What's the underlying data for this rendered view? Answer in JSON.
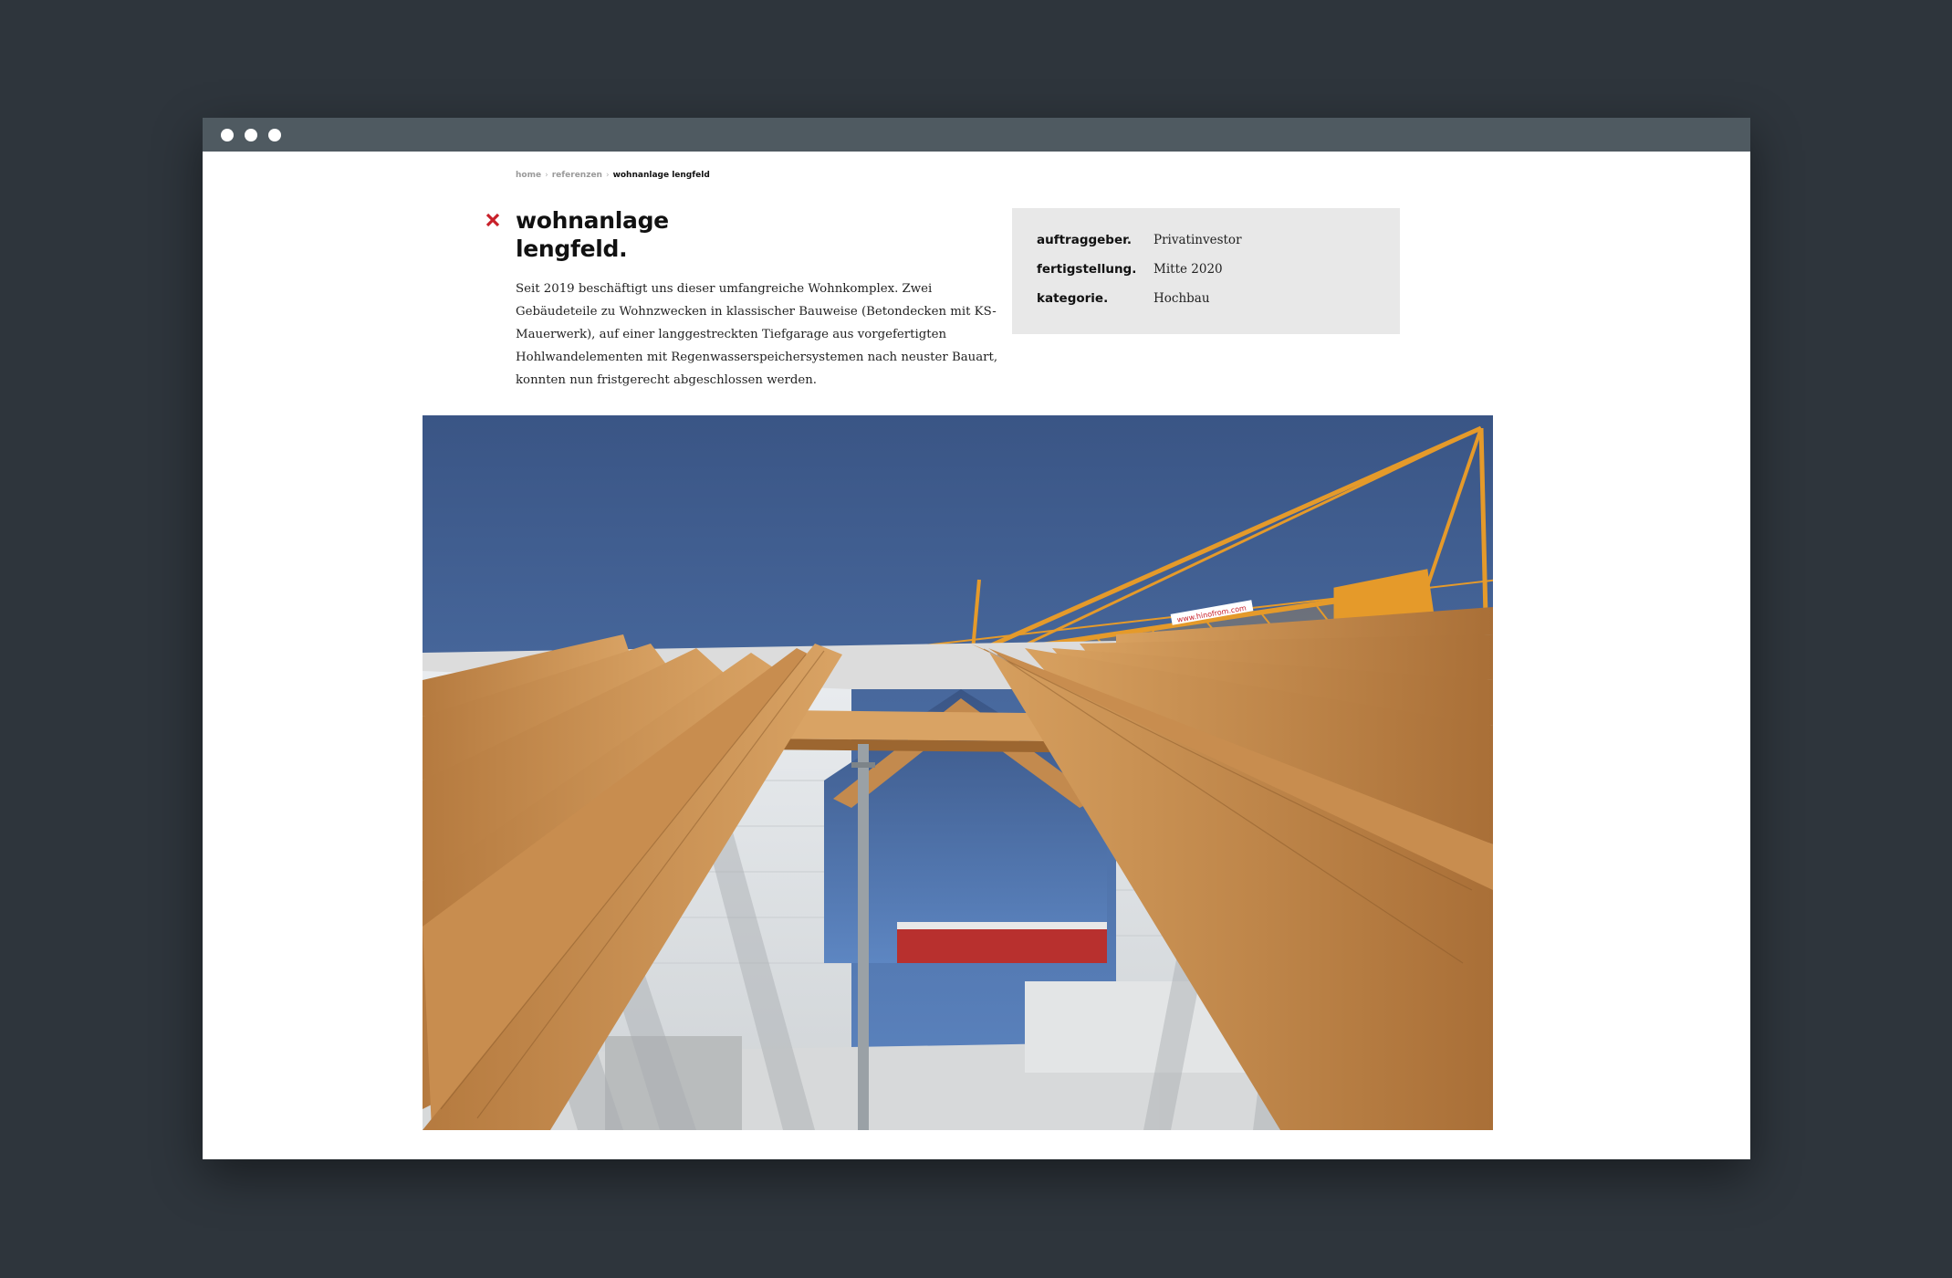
{
  "window": {
    "controls": [
      "dot",
      "dot",
      "dot"
    ]
  },
  "breadcrumb": {
    "items": [
      "home",
      "referenzen",
      "wohnanlage lengfeld"
    ],
    "separator": "›"
  },
  "project": {
    "title_line1": "wohnanlage",
    "title_line2": "lengfeld.",
    "description": "Seit 2019 beschäftigt uns dieser umfangreiche Wohnkomplex. Zwei Gebäudeteile zu Wohnzwecken in klassischer Bauweise (Betondecken mit KS-Mauerwerk), auf einer langgestreckten Tiefgarage aus vorgefertigten Hohlwandelementen mit Regenwasserspeichersystemen nach neuster Bauart, konnten nun fristgerecht abgeschlossen werden."
  },
  "info": [
    {
      "label": "auftraggeber.",
      "value": "Privatinvestor"
    },
    {
      "label": "fertigstellung.",
      "value": "Mitte 2020"
    },
    {
      "label": "kategorie.",
      "value": "Hochbau"
    }
  ],
  "photo": {
    "crane_lettering": "www.hinofrom.com"
  },
  "colors": {
    "background": "#2e353c",
    "titlebar": "#4f5a61",
    "accent": "#c8202a",
    "infobox": "#e8e8e8",
    "sky": "#3f5f92",
    "timber": "#c38a4e",
    "crane": "#e59a2a"
  }
}
